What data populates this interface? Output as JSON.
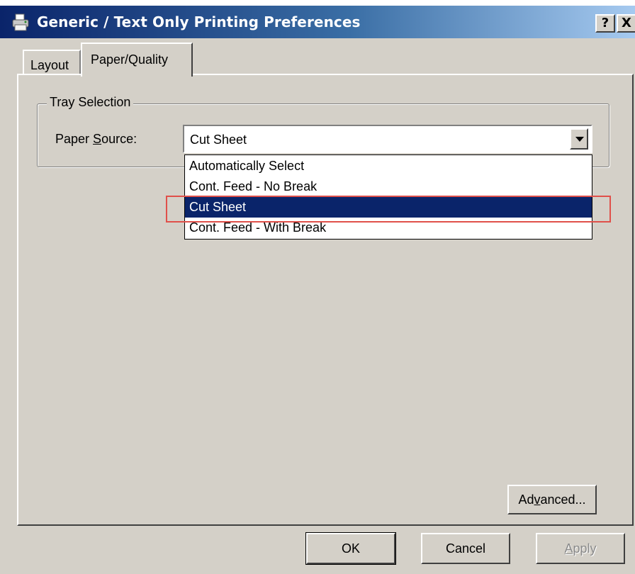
{
  "window": {
    "title": "Generic / Text Only Printing Preferences",
    "icon": "printer-icon",
    "help_label": "?",
    "close_label": "X"
  },
  "tabs": [
    {
      "label": "Layout",
      "active": false
    },
    {
      "label": "Paper/Quality",
      "active": true
    }
  ],
  "tray_selection": {
    "legend": "Tray Selection",
    "paper_source_label_pre": "Paper ",
    "paper_source_label_access": "S",
    "paper_source_label_post": "ource:",
    "selected_value": "Cut Sheet",
    "options": [
      {
        "label": "Automatically Select",
        "selected": false
      },
      {
        "label": "Cont. Feed - No Break",
        "selected": false
      },
      {
        "label": "Cut Sheet",
        "selected": true
      },
      {
        "label": "Cont. Feed - With Break",
        "selected": false
      }
    ]
  },
  "buttons": {
    "advanced_pre": "Ad",
    "advanced_access": "v",
    "advanced_post": "anced...",
    "ok": "OK",
    "cancel": "Cancel",
    "apply_access": "A",
    "apply_post": "pply"
  },
  "colors": {
    "titlebar_start": "#0a246a",
    "titlebar_end": "#a6caf0",
    "selection": "#0a246a",
    "annotation_box": "#e0504a",
    "dialog_bg": "#d4d0c8"
  }
}
